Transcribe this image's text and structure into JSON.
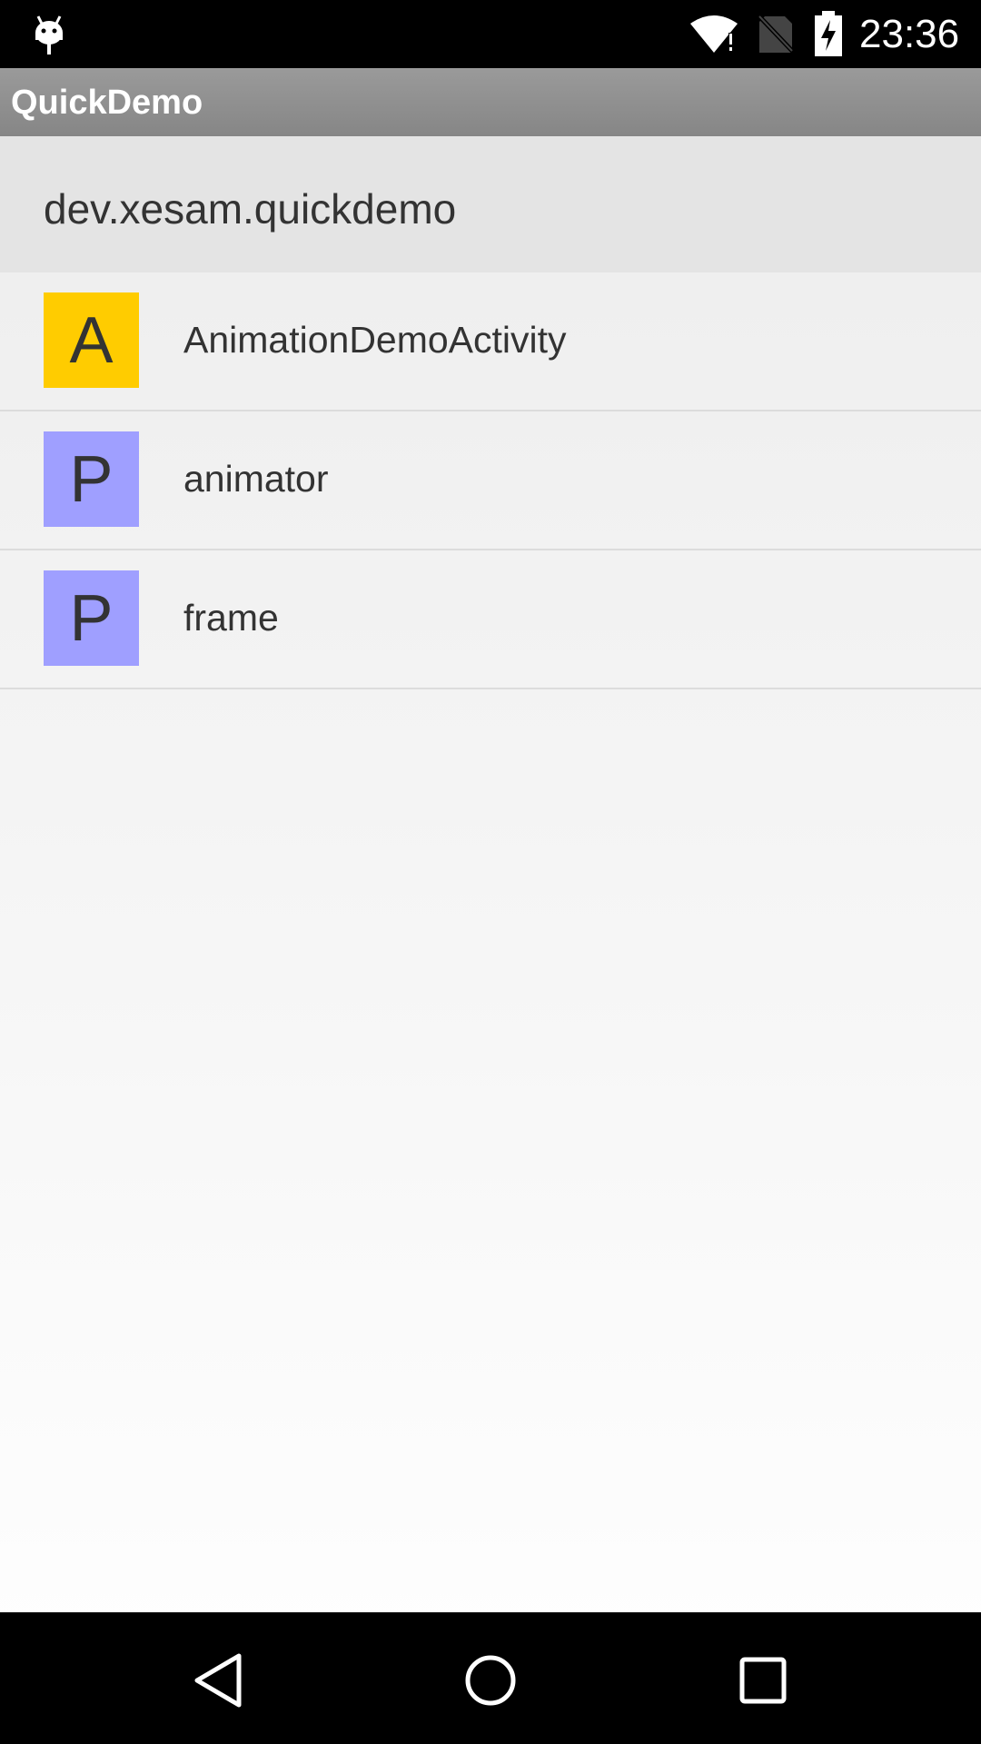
{
  "status_bar": {
    "time": "23:36",
    "icons": [
      "android-debug-icon",
      "wifi-icon",
      "no-sim-icon",
      "battery-charging-icon"
    ]
  },
  "action_bar": {
    "title": "QuickDemo"
  },
  "header": {
    "package_name": "dev.xesam.quickdemo"
  },
  "items": [
    {
      "badge": "A",
      "label": "AnimationDemoActivity",
      "badge_color": "#ffcc00"
    },
    {
      "badge": "P",
      "label": "animator",
      "badge_color": "#9f9fff"
    },
    {
      "badge": "P",
      "label": "frame",
      "badge_color": "#9f9fff"
    }
  ],
  "nav_bar": {
    "buttons": [
      "back-icon",
      "home-icon",
      "recents-icon"
    ]
  }
}
